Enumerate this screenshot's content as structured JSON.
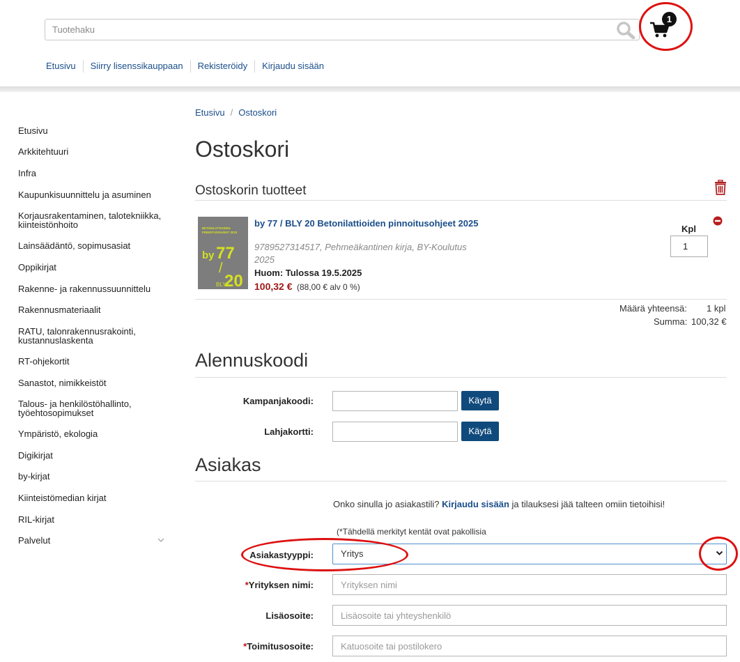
{
  "header": {
    "search_placeholder": "Tuotehaku",
    "cart_count": "1",
    "nav": [
      "Etusivu",
      "Siirry lisenssikauppaan",
      "Rekisteröidy",
      "Kirjaudu sisään"
    ]
  },
  "sidebar": {
    "items": [
      "Etusivu",
      "Arkkitehtuuri",
      "Infra",
      "Kaupunkisuunnittelu ja asuminen",
      "Korjausrakentaminen, talotekniikka, kiinteistönhoito",
      "Lainsäädäntö, sopimusasiat",
      "Oppikirjat",
      "Rakenne- ja rakennussuunnittelu",
      "Rakennusmateriaalit",
      "RATU, talonrakennusrakointi, kustannuslaskenta",
      "RT-ohjekortit",
      "Sanastot, nimikkeistöt",
      "Talous- ja henkilöstöhallinto, työehtosopimukset",
      "Ympäristö, ekologia",
      "Digikirjat",
      "by-kirjat",
      "Kiinteistömedian kirjat",
      "RIL-kirjat",
      "Palvelut"
    ]
  },
  "breadcrumb": {
    "home": "Etusivu",
    "current": "Ostoskori"
  },
  "page_title": "Ostoskori",
  "cart": {
    "section_title": "Ostoskorin tuotteet",
    "product": {
      "title": "by 77 / BLY 20 Betonilattioiden pinnoitusohjeet 2025",
      "meta": "9789527314517, Pehmeäkantinen kirja, BY-Koulutus 2025",
      "availability": "Huom: Tulossa 19.5.2025",
      "price": "100,32 €",
      "vat_note": "(88,00 € alv 0 %)",
      "qty_label": "Kpl",
      "qty": "1",
      "cover": {
        "line1": "BETONILATTIOIDEN",
        "line2": "PINNOITUSOHJEET 2025",
        "by": "by",
        "num_top": "77",
        "slash": "/",
        "bly": "BLY",
        "num_bottom": "20"
      }
    },
    "total_qty_label": "Määrä yhteensä:",
    "total_qty_value": "1 kpl",
    "total_sum_label": "Summa:",
    "total_sum_value": "100,32 €"
  },
  "discount": {
    "title": "Alennuskoodi",
    "campaign_label": "Kampanjakoodi:",
    "gift_label": "Lahjakortti:",
    "apply_label": "Käytä"
  },
  "customer": {
    "title": "Asiakas",
    "login_hint_pre": "Onko sinulla jo asiakastili?",
    "login_link": "Kirjaudu sisään",
    "login_hint_post": "ja tilauksesi jää talteen omiin tietoihisi!",
    "required_note": "(*Tähdellä merkityt kentät ovat pakollisia",
    "type_label": "Asiakastyyppi:",
    "type_value": "Yritys",
    "company_label": "Yrityksen nimi:",
    "company_placeholder": "Yrityksen nimi",
    "extra_label": "Lisäosoite:",
    "extra_placeholder": "Lisäosoite tai yhteyshenkilö",
    "delivery_label": "Toimitusosoite:",
    "delivery_placeholder": "Katuosoite tai postilokero",
    "required_mark": "*"
  },
  "colors": {
    "link": "#1a4e8a",
    "button": "#104a7c",
    "price": "#a01818",
    "annotation_ring": "#dd1111",
    "cover_text": "#d4e021"
  }
}
